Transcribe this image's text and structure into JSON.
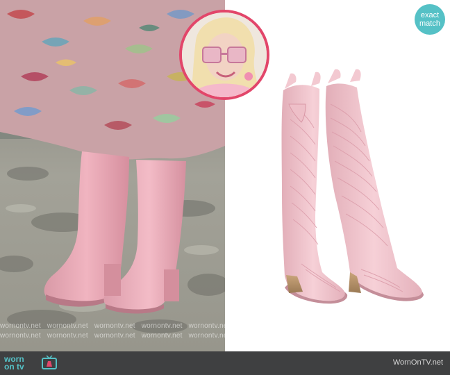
{
  "badge": {
    "line1": "exact",
    "line2": "match",
    "color": "#55c1c6"
  },
  "inset": {
    "border_color": "#e2466a",
    "subject": "portrait of woman with pink sunglasses"
  },
  "left_photo": {
    "subject": "pink cowboy boots worn with floral midi skirt"
  },
  "right_photo": {
    "subject": "pair of pale pink tall western boots"
  },
  "watermark": {
    "text": "wornontv.net"
  },
  "footer": {
    "logo_line1": "worn",
    "logo_line2": "on tv",
    "site_label": "WornOnTV.net",
    "bar_color": "#3f4041"
  },
  "colors": {
    "boot_pink": "#f0c6cd",
    "accent_pink": "#e2466a",
    "brand_teal": "#55c1c6"
  }
}
